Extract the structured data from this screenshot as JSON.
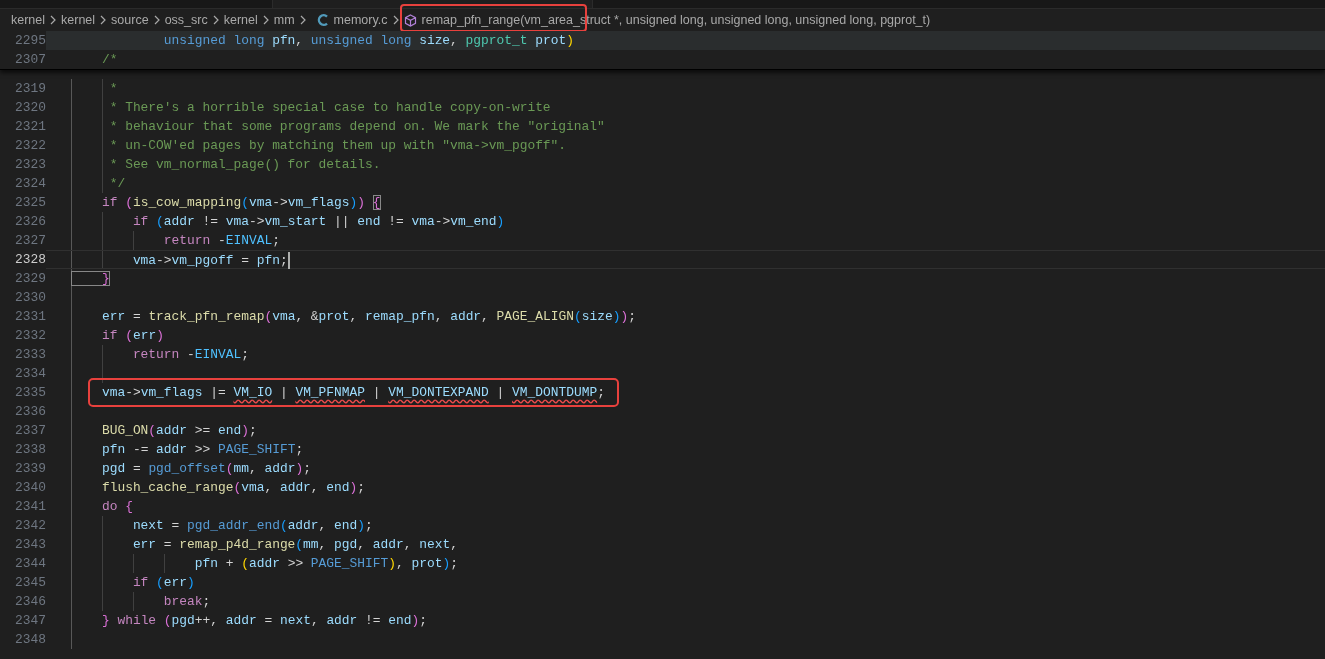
{
  "breadcrumb": [
    {
      "label": "kernel",
      "kind": "folder"
    },
    {
      "label": "kernel",
      "kind": "folder"
    },
    {
      "label": "source",
      "kind": "folder"
    },
    {
      "label": "oss_src",
      "kind": "folder"
    },
    {
      "label": "kernel",
      "kind": "folder"
    },
    {
      "label": "mm",
      "kind": "folder"
    },
    {
      "label": "memory.c",
      "kind": "c-file"
    },
    {
      "label": "remap_pfn_range(vm_area_struct *, unsigned long, unsigned long, unsigned long, pgprot_t)",
      "kind": "symbol",
      "annotated": true
    }
  ],
  "sticky_lines": [
    {
      "number": "2295",
      "highlighted": true,
      "tokens": [
        {
          "text": "            unsigned long",
          "kind": "keyword"
        },
        {
          "text": " pfn",
          "kind": "variable"
        },
        {
          "text": ", ",
          "kind": "plain"
        },
        {
          "text": "unsigned long",
          "kind": "keyword"
        },
        {
          "text": " size",
          "kind": "variable"
        },
        {
          "text": ", ",
          "kind": "plain"
        },
        {
          "text": "pgprot_t",
          "kind": "type"
        },
        {
          "text": " prot",
          "kind": "variable"
        },
        {
          "text": ")",
          "kind": "bracket1"
        }
      ]
    },
    {
      "number": "2307",
      "highlighted": false,
      "tokens": [
        {
          "text": "    /*",
          "kind": "comment"
        }
      ]
    }
  ],
  "lines": [
    {
      "number": "2319",
      "tokens": [
        {
          "text": "     *",
          "kind": "comment"
        }
      ]
    },
    {
      "number": "2320",
      "tokens": [
        {
          "text": "     * There's a horrible special case to handle copy-on-write",
          "kind": "comment"
        }
      ]
    },
    {
      "number": "2321",
      "tokens": [
        {
          "text": "     * behaviour that some programs depend on. We mark the \"original\"",
          "kind": "comment"
        }
      ]
    },
    {
      "number": "2322",
      "tokens": [
        {
          "text": "     * un-COW'ed pages by matching them up with \"vma->vm_pgoff\".",
          "kind": "comment"
        }
      ]
    },
    {
      "number": "2323",
      "tokens": [
        {
          "text": "     * See vm_normal_page() for details.",
          "kind": "comment"
        }
      ]
    },
    {
      "number": "2324",
      "tokens": [
        {
          "text": "     */",
          "kind": "comment"
        }
      ]
    },
    {
      "number": "2325",
      "tokens": [
        {
          "text": "    if ",
          "kind": "control"
        },
        {
          "text": "(",
          "kind": "bracket2"
        },
        {
          "text": "is_cow_mapping",
          "kind": "function"
        },
        {
          "text": "(",
          "kind": "bracket3"
        },
        {
          "text": "vma",
          "kind": "variable"
        },
        {
          "text": "->",
          "kind": "plain"
        },
        {
          "text": "vm_flags",
          "kind": "variable"
        },
        {
          "text": ")",
          "kind": "bracket3"
        },
        {
          "text": ") ",
          "kind": "bracket2"
        },
        {
          "text": "{",
          "kind": "bracket2",
          "match": true
        }
      ]
    },
    {
      "number": "2326",
      "tokens": [
        {
          "text": "        if ",
          "kind": "control"
        },
        {
          "text": "(",
          "kind": "bracket3"
        },
        {
          "text": "addr",
          "kind": "variable"
        },
        {
          "text": " != ",
          "kind": "plain"
        },
        {
          "text": "vma",
          "kind": "variable"
        },
        {
          "text": "->",
          "kind": "plain"
        },
        {
          "text": "vm_start",
          "kind": "variable"
        },
        {
          "text": " || ",
          "kind": "plain"
        },
        {
          "text": "end",
          "kind": "variable"
        },
        {
          "text": " != ",
          "kind": "plain"
        },
        {
          "text": "vma",
          "kind": "variable"
        },
        {
          "text": "->",
          "kind": "plain"
        },
        {
          "text": "vm_end",
          "kind": "variable"
        },
        {
          "text": ")",
          "kind": "bracket3"
        }
      ]
    },
    {
      "number": "2327",
      "tokens": [
        {
          "text": "            return",
          "kind": "control"
        },
        {
          "text": " -",
          "kind": "plain"
        },
        {
          "text": "EINVAL",
          "kind": "constant"
        },
        {
          "text": ";",
          "kind": "plain"
        }
      ]
    },
    {
      "number": "2328",
      "current": true,
      "tokens": [
        {
          "text": "        vma",
          "kind": "variable"
        },
        {
          "text": "->",
          "kind": "plain"
        },
        {
          "text": "vm_pgoff",
          "kind": "variable"
        },
        {
          "text": " = ",
          "kind": "plain"
        },
        {
          "text": "pfn",
          "kind": "variable"
        },
        {
          "text": ";",
          "kind": "plain"
        }
      ]
    },
    {
      "number": "2329",
      "tokens": [
        {
          "text": "    }",
          "kind": "bracket2",
          "match": true
        }
      ]
    },
    {
      "number": "2330"
    },
    {
      "number": "2331",
      "tokens": [
        {
          "text": "    err",
          "kind": "variable"
        },
        {
          "text": " = ",
          "kind": "plain"
        },
        {
          "text": "track_pfn_remap",
          "kind": "function"
        },
        {
          "text": "(",
          "kind": "bracket2"
        },
        {
          "text": "vma",
          "kind": "variable"
        },
        {
          "text": ", &",
          "kind": "plain"
        },
        {
          "text": "prot",
          "kind": "variable"
        },
        {
          "text": ", ",
          "kind": "plain"
        },
        {
          "text": "remap_pfn",
          "kind": "variable"
        },
        {
          "text": ", ",
          "kind": "plain"
        },
        {
          "text": "addr",
          "kind": "variable"
        },
        {
          "text": ", ",
          "kind": "plain"
        },
        {
          "text": "PAGE_ALIGN",
          "kind": "function"
        },
        {
          "text": "(",
          "kind": "bracket3"
        },
        {
          "text": "size",
          "kind": "variable"
        },
        {
          "text": ")",
          "kind": "bracket3"
        },
        {
          "text": ")",
          "kind": "bracket2"
        },
        {
          "text": ";",
          "kind": "plain"
        }
      ]
    },
    {
      "number": "2332",
      "tokens": [
        {
          "text": "    if ",
          "kind": "control"
        },
        {
          "text": "(",
          "kind": "bracket2"
        },
        {
          "text": "err",
          "kind": "variable"
        },
        {
          "text": ")",
          "kind": "bracket2"
        }
      ]
    },
    {
      "number": "2333",
      "tokens": [
        {
          "text": "        return",
          "kind": "control"
        },
        {
          "text": " -",
          "kind": "plain"
        },
        {
          "text": "EINVAL",
          "kind": "constant"
        },
        {
          "text": ";",
          "kind": "plain"
        }
      ]
    },
    {
      "number": "2334"
    },
    {
      "number": "2335",
      "annotated": true,
      "tokens": [
        {
          "text": "    vma",
          "kind": "variable"
        },
        {
          "text": "->",
          "kind": "plain"
        },
        {
          "text": "vm_flags",
          "kind": "variable"
        },
        {
          "text": " |= ",
          "kind": "plain"
        },
        {
          "text": "VM_IO",
          "kind": "variable",
          "error": true
        },
        {
          "text": " | ",
          "kind": "plain"
        },
        {
          "text": "VM_PFNMAP",
          "kind": "variable",
          "error": true
        },
        {
          "text": " | ",
          "kind": "plain"
        },
        {
          "text": "VM_DONTEXPAND",
          "kind": "variable",
          "error": true
        },
        {
          "text": " | ",
          "kind": "plain"
        },
        {
          "text": "VM_DONTDUMP",
          "kind": "variable",
          "error": true
        },
        {
          "text": ";",
          "kind": "plain"
        }
      ]
    },
    {
      "number": "2336"
    },
    {
      "number": "2337",
      "tokens": [
        {
          "text": "    BUG_ON",
          "kind": "function"
        },
        {
          "text": "(",
          "kind": "bracket2"
        },
        {
          "text": "addr",
          "kind": "variable"
        },
        {
          "text": " >= ",
          "kind": "plain"
        },
        {
          "text": "end",
          "kind": "variable"
        },
        {
          "text": ")",
          "kind": "bracket2"
        },
        {
          "text": ";",
          "kind": "plain"
        }
      ]
    },
    {
      "number": "2338",
      "tokens": [
        {
          "text": "    pfn",
          "kind": "variable"
        },
        {
          "text": " -= ",
          "kind": "plain"
        },
        {
          "text": "addr",
          "kind": "variable"
        },
        {
          "text": " >> ",
          "kind": "plain"
        },
        {
          "text": "PAGE_SHIFT",
          "kind": "macro"
        },
        {
          "text": ";",
          "kind": "plain"
        }
      ]
    },
    {
      "number": "2339",
      "tokens": [
        {
          "text": "    pgd",
          "kind": "variable"
        },
        {
          "text": " = ",
          "kind": "plain"
        },
        {
          "text": "pgd_offset",
          "kind": "macro"
        },
        {
          "text": "(",
          "kind": "bracket2"
        },
        {
          "text": "mm",
          "kind": "variable"
        },
        {
          "text": ", ",
          "kind": "plain"
        },
        {
          "text": "addr",
          "kind": "variable"
        },
        {
          "text": ")",
          "kind": "bracket2"
        },
        {
          "text": ";",
          "kind": "plain"
        }
      ]
    },
    {
      "number": "2340",
      "tokens": [
        {
          "text": "    flush_cache_range",
          "kind": "function"
        },
        {
          "text": "(",
          "kind": "bracket2"
        },
        {
          "text": "vma",
          "kind": "variable"
        },
        {
          "text": ", ",
          "kind": "plain"
        },
        {
          "text": "addr",
          "kind": "variable"
        },
        {
          "text": ", ",
          "kind": "plain"
        },
        {
          "text": "end",
          "kind": "variable"
        },
        {
          "text": ")",
          "kind": "bracket2"
        },
        {
          "text": ";",
          "kind": "plain"
        }
      ]
    },
    {
      "number": "2341",
      "tokens": [
        {
          "text": "    do ",
          "kind": "control"
        },
        {
          "text": "{",
          "kind": "bracket2"
        }
      ]
    },
    {
      "number": "2342",
      "tokens": [
        {
          "text": "        next",
          "kind": "variable"
        },
        {
          "text": " = ",
          "kind": "plain"
        },
        {
          "text": "pgd_addr_end",
          "kind": "macro"
        },
        {
          "text": "(",
          "kind": "bracket3"
        },
        {
          "text": "addr",
          "kind": "variable"
        },
        {
          "text": ", ",
          "kind": "plain"
        },
        {
          "text": "end",
          "kind": "variable"
        },
        {
          "text": ")",
          "kind": "bracket3"
        },
        {
          "text": ";",
          "kind": "plain"
        }
      ]
    },
    {
      "number": "2343",
      "tokens": [
        {
          "text": "        err",
          "kind": "variable"
        },
        {
          "text": " = ",
          "kind": "plain"
        },
        {
          "text": "remap_p4d_range",
          "kind": "function"
        },
        {
          "text": "(",
          "kind": "bracket3"
        },
        {
          "text": "mm",
          "kind": "variable"
        },
        {
          "text": ", ",
          "kind": "plain"
        },
        {
          "text": "pgd",
          "kind": "variable"
        },
        {
          "text": ", ",
          "kind": "plain"
        },
        {
          "text": "addr",
          "kind": "variable"
        },
        {
          "text": ", ",
          "kind": "plain"
        },
        {
          "text": "next",
          "kind": "variable"
        },
        {
          "text": ",",
          "kind": "plain"
        }
      ]
    },
    {
      "number": "2344",
      "tokens": [
        {
          "text": "                pfn",
          "kind": "variable"
        },
        {
          "text": " + ",
          "kind": "plain"
        },
        {
          "text": "(",
          "kind": "bracket1"
        },
        {
          "text": "addr",
          "kind": "variable"
        },
        {
          "text": " >> ",
          "kind": "plain"
        },
        {
          "text": "PAGE_SHIFT",
          "kind": "macro"
        },
        {
          "text": ")",
          "kind": "bracket1"
        },
        {
          "text": ", ",
          "kind": "plain"
        },
        {
          "text": "prot",
          "kind": "variable"
        },
        {
          "text": ")",
          "kind": "bracket3"
        },
        {
          "text": ";",
          "kind": "plain"
        }
      ]
    },
    {
      "number": "2345",
      "tokens": [
        {
          "text": "        if ",
          "kind": "control"
        },
        {
          "text": "(",
          "kind": "bracket3"
        },
        {
          "text": "err",
          "kind": "variable"
        },
        {
          "text": ")",
          "kind": "bracket3"
        }
      ]
    },
    {
      "number": "2346",
      "tokens": [
        {
          "text": "            break",
          "kind": "control"
        },
        {
          "text": ";",
          "kind": "plain"
        }
      ]
    },
    {
      "number": "2347",
      "tokens": [
        {
          "text": "    }",
          "kind": "bracket2"
        },
        {
          "text": " while ",
          "kind": "control"
        },
        {
          "text": "(",
          "kind": "bracket2"
        },
        {
          "text": "pgd",
          "kind": "variable"
        },
        {
          "text": "++, ",
          "kind": "plain"
        },
        {
          "text": "addr",
          "kind": "variable"
        },
        {
          "text": " = ",
          "kind": "plain"
        },
        {
          "text": "next",
          "kind": "variable"
        },
        {
          "text": ", ",
          "kind": "plain"
        },
        {
          "text": "addr",
          "kind": "variable"
        },
        {
          "text": " != ",
          "kind": "plain"
        },
        {
          "text": "end",
          "kind": "variable"
        },
        {
          "text": ")",
          "kind": "bracket2"
        },
        {
          "text": ";",
          "kind": "plain"
        }
      ]
    },
    {
      "number": "2348"
    }
  ]
}
